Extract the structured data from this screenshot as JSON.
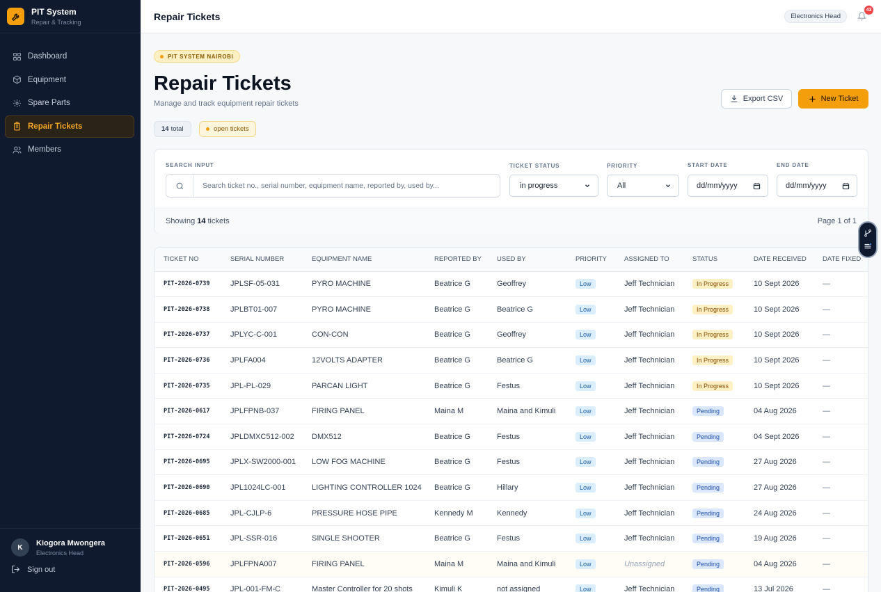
{
  "app": {
    "name": "PIT System",
    "subtitle": "Repair & Tracking"
  },
  "sidebar": {
    "items": [
      {
        "label": "Dashboard",
        "icon": "grid-icon"
      },
      {
        "label": "Equipment",
        "icon": "box-icon"
      },
      {
        "label": "Spare Parts",
        "icon": "cog-icon"
      },
      {
        "label": "Repair Tickets",
        "icon": "clipboard-icon",
        "active": true
      },
      {
        "label": "Members",
        "icon": "users-icon"
      }
    ]
  },
  "user": {
    "initial": "K",
    "name": "Kiogora Mwongera",
    "role": "Electronics Head",
    "signout": "Sign out"
  },
  "topbar": {
    "title": "Repair Tickets",
    "role": "Electronics Head",
    "notifications": "43"
  },
  "page": {
    "location_chip": "PIT SYSTEM NAIROBI",
    "title": "Repair Tickets",
    "subtitle": "Manage and track equipment repair tickets",
    "export_label": "Export CSV",
    "new_label": "New Ticket",
    "total_count": "14",
    "total_label": "total",
    "open_label": "open tickets"
  },
  "filters": {
    "search_label": "SEARCH INPUT",
    "search_placeholder": "Search ticket no., serial number, equipment name, reported by, used by...",
    "status_label": "TICKET STATUS",
    "status_value": "in progress",
    "priority_label": "PRIORITY",
    "priority_value": "All",
    "start_label": "START DATE",
    "start_value": "dd/mm/yyyy",
    "end_label": "END DATE",
    "end_value": "dd/mm/yyyy",
    "showing_prefix": "Showing",
    "showing_count": "14",
    "showing_suffix": "tickets",
    "page_info": "Page 1 of 1"
  },
  "table": {
    "columns": [
      "TICKET NO",
      "SERIAL NUMBER",
      "EQUIPMENT NAME",
      "REPORTED BY",
      "USED BY",
      "PRIORITY",
      "ASSIGNED TO",
      "STATUS",
      "DATE RECEIVED",
      "DATE FIXED"
    ],
    "rows": [
      {
        "ticket": "PIT-2026-0739",
        "serial": "JPLSF-05-031",
        "equipment": "PYRO MACHINE",
        "reported": "Beatrice G",
        "used": "Geoffrey",
        "priority": "Low",
        "assigned": "Jeff Technician",
        "status": "In Progress",
        "received": "10 Sept 2026",
        "fixed": "—"
      },
      {
        "ticket": "PIT-2026-0738",
        "serial": "JPLBT01-007",
        "equipment": "PYRO MACHINE",
        "reported": "Beatrice G",
        "used": "Beatrice G",
        "priority": "Low",
        "assigned": "Jeff Technician",
        "status": "In Progress",
        "received": "10 Sept 2026",
        "fixed": "—"
      },
      {
        "ticket": "PIT-2026-0737",
        "serial": "JPLYC-C-001",
        "equipment": "CON-CON",
        "reported": "Beatrice G",
        "used": "Geoffrey",
        "priority": "Low",
        "assigned": "Jeff Technician",
        "status": "In Progress",
        "received": "10 Sept 2026",
        "fixed": "—"
      },
      {
        "ticket": "PIT-2026-0736",
        "serial": "JPLFA004",
        "equipment": "12VOLTS ADAPTER",
        "reported": "Beatrice G",
        "used": "Beatrice G",
        "priority": "Low",
        "assigned": "Jeff Technician",
        "status": "In Progress",
        "received": "10 Sept 2026",
        "fixed": "—"
      },
      {
        "ticket": "PIT-2026-0735",
        "serial": "JPL-PL-029",
        "equipment": "PARCAN LIGHT",
        "reported": "Beatrice G",
        "used": "Festus",
        "priority": "Low",
        "assigned": "Jeff Technician",
        "status": "In Progress",
        "received": "10 Sept 2026",
        "fixed": "—"
      },
      {
        "ticket": "PIT-2026-0617",
        "serial": "JPLFPNB-037",
        "equipment": "FIRING PANEL",
        "reported": "Maina M",
        "used": "Maina and Kimuli",
        "priority": "Low",
        "assigned": "Jeff Technician",
        "status": "Pending",
        "received": "04 Aug 2026",
        "fixed": "—"
      },
      {
        "ticket": "PIT-2026-0724",
        "serial": "JPLDMXC512-002",
        "equipment": "DMX512",
        "reported": "Beatrice G",
        "used": "Festus",
        "priority": "Low",
        "assigned": "Jeff Technician",
        "status": "Pending",
        "received": "04 Sept 2026",
        "fixed": "—"
      },
      {
        "ticket": "PIT-2026-0695",
        "serial": "JPLX-SW2000-001",
        "equipment": "LOW FOG MACHINE",
        "reported": "Beatrice G",
        "used": "Festus",
        "priority": "Low",
        "assigned": "Jeff Technician",
        "status": "Pending",
        "received": "27 Aug 2026",
        "fixed": "—"
      },
      {
        "ticket": "PIT-2026-0690",
        "serial": "JPL1024LC-001",
        "equipment": "LIGHTING CONTROLLER 1024",
        "reported": "Beatrice G",
        "used": "Hillary",
        "priority": "Low",
        "assigned": "Jeff Technician",
        "status": "Pending",
        "received": "27 Aug 2026",
        "fixed": "—"
      },
      {
        "ticket": "PIT-2026-0685",
        "serial": "JPL-CJLP-6",
        "equipment": "PRESSURE HOSE PIPE",
        "reported": "Kennedy M",
        "used": "Kennedy",
        "priority": "Low",
        "assigned": "Jeff Technician",
        "status": "Pending",
        "received": "24 Aug 2026",
        "fixed": "—"
      },
      {
        "ticket": "PIT-2026-0651",
        "serial": "JPL-SSR-016",
        "equipment": "SINGLE SHOOTER",
        "reported": "Beatrice G",
        "used": "Festus",
        "priority": "Low",
        "assigned": "Jeff Technician",
        "status": "Pending",
        "received": "19 Aug 2026",
        "fixed": "—"
      },
      {
        "ticket": "PIT-2026-0596",
        "serial": "JPLFPNA007",
        "equipment": "FIRING PANEL",
        "reported": "Maina M",
        "used": "Maina and Kimuli",
        "priority": "Low",
        "assigned": "Unassigned",
        "status": "Pending",
        "received": "04 Aug 2026",
        "fixed": "—",
        "highlight": true
      },
      {
        "ticket": "PIT-2026-0495",
        "serial": "JPL-001-FM-C",
        "equipment": "Master Controller for 20 shots",
        "reported": "Kimuli K",
        "used": "not assigned",
        "priority": "Low",
        "assigned": "Jeff Technician",
        "status": "Pending",
        "received": "13 Jul 2026",
        "fixed": "—"
      }
    ]
  },
  "colors": {
    "accent": "#f59e0b",
    "sidebar": "#0f1a2e",
    "active_text": "#f5a524"
  }
}
